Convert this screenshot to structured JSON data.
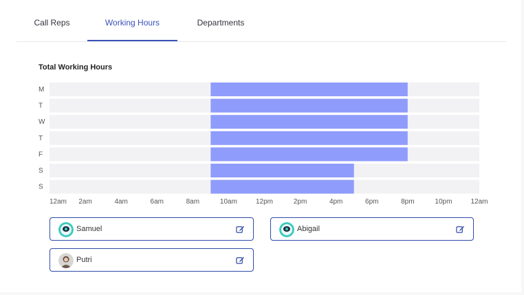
{
  "tabs": [
    {
      "label": "Call Reps",
      "active": false
    },
    {
      "label": "Working Hours",
      "active": true
    },
    {
      "label": "Departments",
      "active": false
    }
  ],
  "section_title": "Total Working Hours",
  "chart_data": {
    "type": "bar",
    "orientation": "horizontal-range",
    "categories": [
      "M",
      "T",
      "W",
      "T",
      "F",
      "S",
      "S"
    ],
    "ranges": [
      [
        9,
        20
      ],
      [
        9,
        20
      ],
      [
        9,
        20
      ],
      [
        9,
        20
      ],
      [
        9,
        20
      ],
      [
        9,
        17
      ],
      [
        9,
        17
      ]
    ],
    "x_ticks": [
      "12am",
      "2am",
      "4am",
      "6am",
      "8am",
      "10am",
      "12pm",
      "2pm",
      "4pm",
      "6pm",
      "8pm",
      "10pm",
      "12am"
    ],
    "xlim": [
      0,
      24
    ],
    "colors": {
      "bar": "#8f9cfb",
      "track": "#f2f2f4"
    }
  },
  "reps": [
    {
      "name": "Samuel",
      "avatar": "teal-avatar-icon"
    },
    {
      "name": "Abigail",
      "avatar": "teal-avatar-icon"
    },
    {
      "name": "Putri",
      "avatar": "photo-avatar-icon"
    }
  ],
  "colors": {
    "accent": "#2e4aa8",
    "active_tab": "#3a52b8"
  }
}
